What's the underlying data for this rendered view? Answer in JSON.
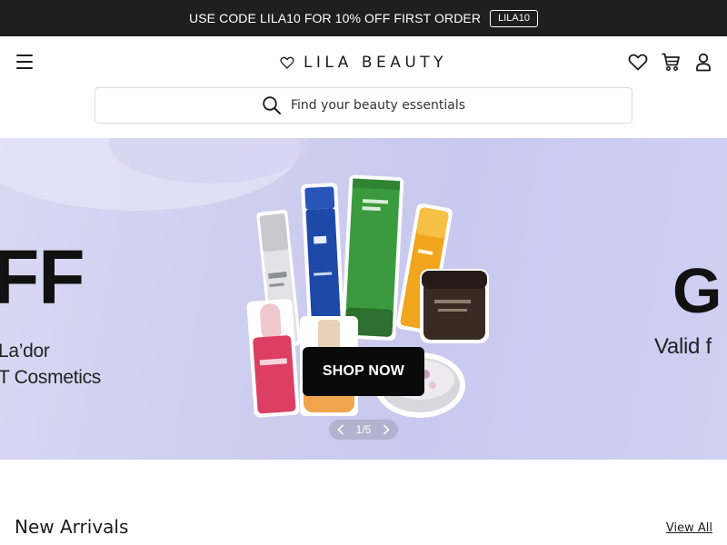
{
  "promo": {
    "text": "USE CODE LILA10 FOR 10% OFF FIRST ORDER",
    "code": "LILA10"
  },
  "header": {
    "logo_text": "LILA BEAUTY",
    "icons": [
      "menu-icon",
      "heart-icon",
      "cart-icon",
      "user-icon"
    ]
  },
  "search": {
    "placeholder": "Find your beauty essentials"
  },
  "hero": {
    "left_headline": "FF",
    "left_sub_1": "La’dor",
    "left_sub_2": "T Cosmetics",
    "right_headline": "G",
    "right_sub": "Valid f",
    "cta_label": "SHOP NOW",
    "pager": "1/5",
    "background": "#cfcff0"
  },
  "new_arrivals": {
    "title": "New Arrivals",
    "view_all": "View All"
  },
  "colors": {
    "promo_bg": "#1f1f1f",
    "cta_bg": "#0a0a0a"
  }
}
